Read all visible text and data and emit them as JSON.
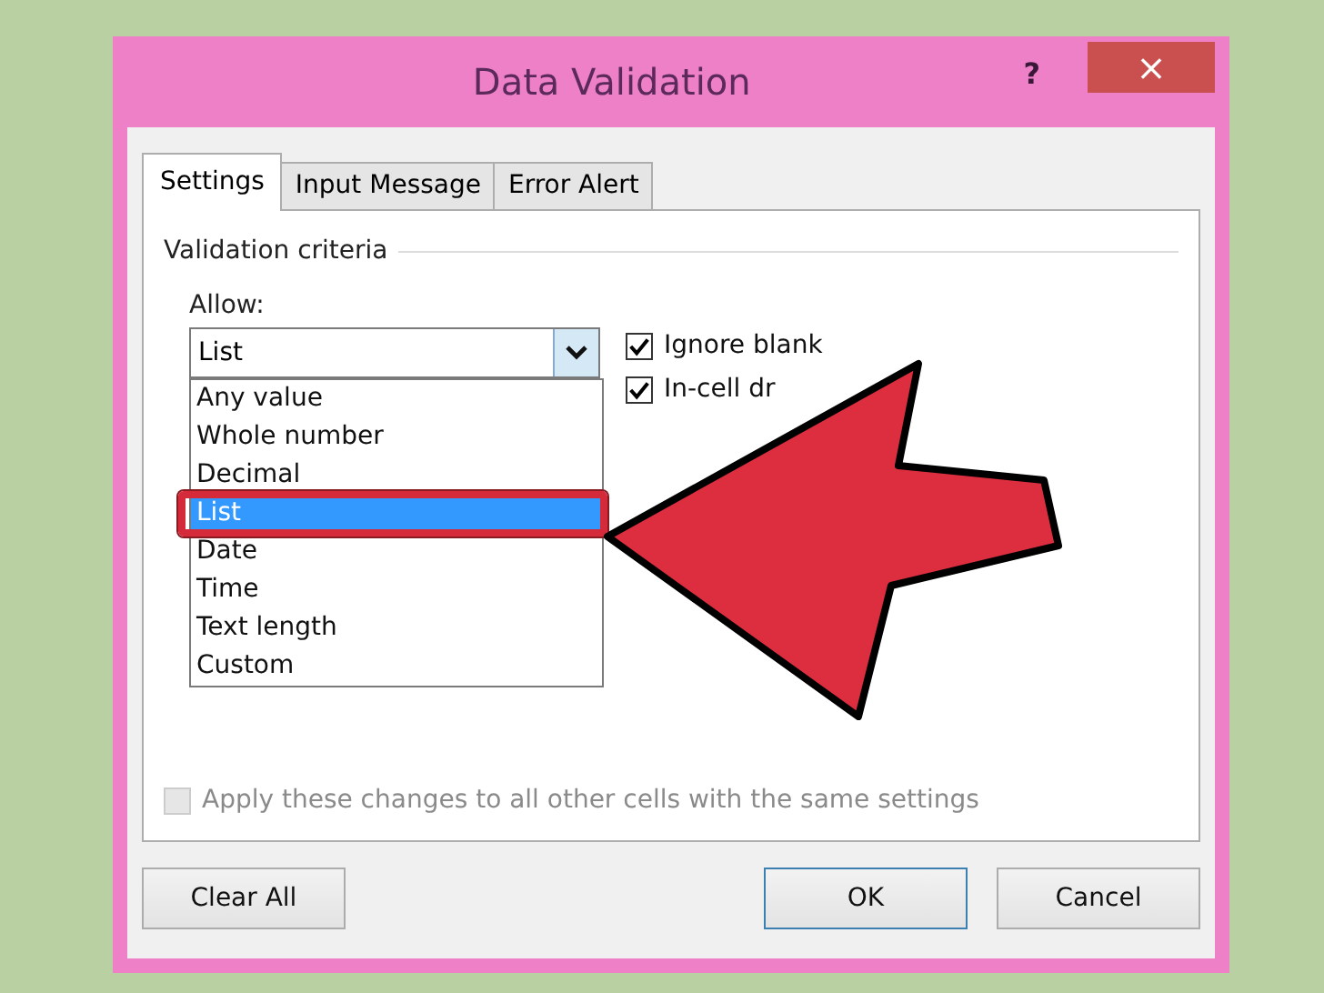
{
  "window": {
    "title": "Data Validation",
    "help": "?",
    "close": "×"
  },
  "tabs": [
    {
      "label": "Settings",
      "selected": true
    },
    {
      "label": "Input Message",
      "selected": false
    },
    {
      "label": "Error Alert",
      "selected": false
    }
  ],
  "group": {
    "label": "Validation criteria"
  },
  "allow": {
    "label": "Allow:",
    "value": "List",
    "expanded": true,
    "options": [
      {
        "label": "Any value",
        "selected": false
      },
      {
        "label": "Whole number",
        "selected": false
      },
      {
        "label": "Decimal",
        "selected": false
      },
      {
        "label": "List",
        "selected": true
      },
      {
        "label": "Date",
        "selected": false
      },
      {
        "label": "Time",
        "selected": false
      },
      {
        "label": "Text length",
        "selected": false
      },
      {
        "label": "Custom",
        "selected": false
      }
    ]
  },
  "checkboxes": [
    {
      "label": "Ignore blank",
      "checked": true,
      "disabled": false
    },
    {
      "label": "In-cell dr",
      "checked": true,
      "disabled": false
    }
  ],
  "apply": {
    "label": "Apply these changes to all other cells with the same settings",
    "checked": false,
    "disabled": true
  },
  "buttons": [
    {
      "label": "Clear All",
      "kind": "normal"
    },
    {
      "label": "OK",
      "kind": "default"
    },
    {
      "label": "Cancel",
      "kind": "normal"
    }
  ]
}
